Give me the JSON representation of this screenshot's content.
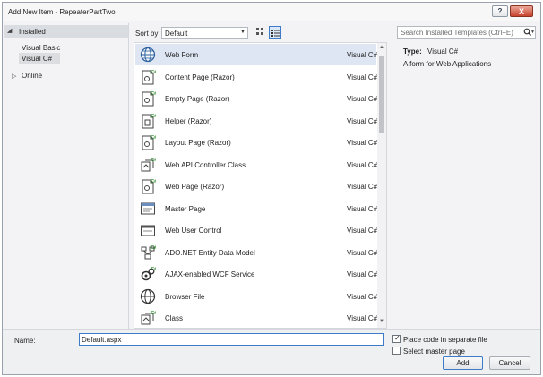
{
  "window": {
    "title": "Add New Item - RepeaterPartTwo",
    "help_glyph": "?",
    "close_glyph": "X"
  },
  "sidebar": {
    "installed_label": "Installed",
    "items": [
      {
        "label": "Visual Basic"
      },
      {
        "label": "Visual C#",
        "selected": true
      }
    ],
    "online_label": "Online"
  },
  "toolbar": {
    "sort_label": "Sort by:",
    "sort_value": "Default"
  },
  "search": {
    "placeholder": "Search Installed Templates (Ctrl+E)"
  },
  "templates": [
    {
      "name": "Web Form",
      "lang": "Visual C#",
      "icon": "web-form-icon",
      "selected": true
    },
    {
      "name": "Content Page (Razor)",
      "lang": "Visual C#",
      "icon": "content-page-icon"
    },
    {
      "name": "Empty Page (Razor)",
      "lang": "Visual C#",
      "icon": "empty-page-icon"
    },
    {
      "name": "Helper (Razor)",
      "lang": "Visual C#",
      "icon": "helper-icon"
    },
    {
      "name": "Layout Page (Razor)",
      "lang": "Visual C#",
      "icon": "layout-page-icon"
    },
    {
      "name": "Web API Controller Class",
      "lang": "Visual C#",
      "icon": "api-controller-icon"
    },
    {
      "name": "Web Page (Razor)",
      "lang": "Visual C#",
      "icon": "web-page-icon"
    },
    {
      "name": "Master Page",
      "lang": "Visual C#",
      "icon": "master-page-icon"
    },
    {
      "name": "Web User Control",
      "lang": "Visual C#",
      "icon": "user-control-icon"
    },
    {
      "name": "ADO.NET Entity Data Model",
      "lang": "Visual C#",
      "icon": "entity-model-icon"
    },
    {
      "name": "AJAX-enabled WCF Service",
      "lang": "Visual C#",
      "icon": "wcf-service-icon"
    },
    {
      "name": "Browser File",
      "lang": "Visual C#",
      "icon": "browser-file-icon"
    },
    {
      "name": "Class",
      "lang": "Visual C#",
      "icon": "class-icon"
    }
  ],
  "info": {
    "type_label": "Type:",
    "type_value": "Visual C#",
    "description": "A form for Web Applications"
  },
  "bottom": {
    "name_label": "Name:",
    "name_value": "Default.aspx",
    "code_separate_label": "Place code in separate file",
    "code_separate_checked": true,
    "master_page_label": "Select master page",
    "master_page_checked": false,
    "add_label": "Add",
    "cancel_label": "Cancel"
  },
  "colors": {
    "selection": "#dfe6f3",
    "accent": "#3d7bc8",
    "csharp_badge": "#2e8b2e"
  }
}
